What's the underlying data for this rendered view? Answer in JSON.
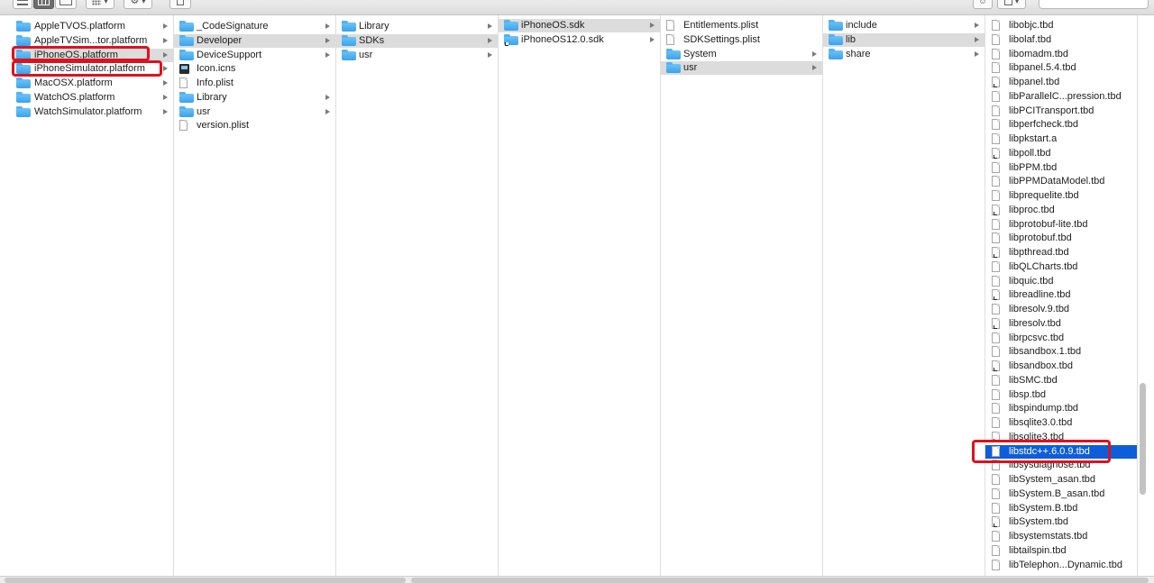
{
  "toolbar": {
    "buttons": [
      {
        "name": "list-view-icon"
      },
      {
        "name": "column-view-icon"
      },
      {
        "name": "cover-flow-icon"
      },
      {
        "name": "arrange-icon"
      },
      {
        "name": "action-gear-icon"
      },
      {
        "name": "share-icon"
      },
      {
        "name": "user-icon"
      },
      {
        "name": "tags-icon"
      }
    ],
    "search_placeholder": ""
  },
  "columns": [
    {
      "items": [
        {
          "label": "AppleTVOS.platform",
          "type": "folder",
          "arrow": true
        },
        {
          "label": "AppleTVSim...tor.platform",
          "type": "folder",
          "arrow": true
        },
        {
          "label": "iPhoneOS.platform",
          "type": "folder",
          "arrow": true,
          "state": "highlight"
        },
        {
          "label": "iPhoneSimulator.platform",
          "type": "folder",
          "arrow": true
        },
        {
          "label": "MacOSX.platform",
          "type": "folder",
          "arrow": true
        },
        {
          "label": "WatchOS.platform",
          "type": "folder",
          "arrow": true
        },
        {
          "label": "WatchSimulator.platform",
          "type": "folder",
          "arrow": true
        }
      ]
    },
    {
      "items": [
        {
          "label": "_CodeSignature",
          "type": "folder",
          "arrow": true
        },
        {
          "label": "Developer",
          "type": "folder",
          "arrow": true,
          "state": "highlight"
        },
        {
          "label": "DeviceSupport",
          "type": "folder",
          "arrow": true
        },
        {
          "label": "Icon.icns",
          "type": "exec"
        },
        {
          "label": "Info.plist",
          "type": "doc"
        },
        {
          "label": "Library",
          "type": "folder",
          "arrow": true
        },
        {
          "label": "usr",
          "type": "folder",
          "arrow": true
        },
        {
          "label": "version.plist",
          "type": "doc"
        }
      ]
    },
    {
      "items": [
        {
          "label": "Library",
          "type": "folder",
          "arrow": true
        },
        {
          "label": "SDKs",
          "type": "folder",
          "arrow": true,
          "state": "highlight"
        },
        {
          "label": "usr",
          "type": "folder",
          "arrow": true
        }
      ]
    },
    {
      "items": [
        {
          "label": "iPhoneOS.sdk",
          "type": "folder",
          "arrow": true,
          "state": "highlight"
        },
        {
          "label": "iPhoneOS12.0.sdk",
          "type": "folder",
          "arrow": true,
          "alias": true
        }
      ]
    },
    {
      "items": [
        {
          "label": "Entitlements.plist",
          "type": "doc"
        },
        {
          "label": "SDKSettings.plist",
          "type": "doc"
        },
        {
          "label": "System",
          "type": "folder",
          "arrow": true
        },
        {
          "label": "usr",
          "type": "folder",
          "arrow": true,
          "state": "highlight"
        }
      ]
    },
    {
      "items": [
        {
          "label": "include",
          "type": "folder",
          "arrow": true
        },
        {
          "label": "lib",
          "type": "folder",
          "arrow": true,
          "state": "highlight"
        },
        {
          "label": "share",
          "type": "folder",
          "arrow": true
        }
      ]
    },
    {
      "items": [
        {
          "label": "libobjc.tbd",
          "type": "doc"
        },
        {
          "label": "libolaf.tbd",
          "type": "doc"
        },
        {
          "label": "libomadm.tbd",
          "type": "doc"
        },
        {
          "label": "libpanel.5.4.tbd",
          "type": "doc"
        },
        {
          "label": "libpanel.tbd",
          "type": "doc",
          "alias": true
        },
        {
          "label": "libParallelC...pression.tbd",
          "type": "doc"
        },
        {
          "label": "libPCITransport.tbd",
          "type": "doc"
        },
        {
          "label": "libperfcheck.tbd",
          "type": "doc"
        },
        {
          "label": "libpkstart.a",
          "type": "doc"
        },
        {
          "label": "libpoll.tbd",
          "type": "doc",
          "alias": true
        },
        {
          "label": "libPPM.tbd",
          "type": "doc"
        },
        {
          "label": "libPPMDataModel.tbd",
          "type": "doc"
        },
        {
          "label": "libprequelite.tbd",
          "type": "doc"
        },
        {
          "label": "libproc.tbd",
          "type": "doc",
          "alias": true
        },
        {
          "label": "libprotobuf-lite.tbd",
          "type": "doc"
        },
        {
          "label": "libprotobuf.tbd",
          "type": "doc"
        },
        {
          "label": "libpthread.tbd",
          "type": "doc",
          "alias": true
        },
        {
          "label": "libQLCharts.tbd",
          "type": "doc"
        },
        {
          "label": "libquic.tbd",
          "type": "doc"
        },
        {
          "label": "libreadline.tbd",
          "type": "doc",
          "alias": true
        },
        {
          "label": "libresolv.9.tbd",
          "type": "doc"
        },
        {
          "label": "libresolv.tbd",
          "type": "doc",
          "alias": true
        },
        {
          "label": "librpcsvc.tbd",
          "type": "doc"
        },
        {
          "label": "libsandbox.1.tbd",
          "type": "doc"
        },
        {
          "label": "libsandbox.tbd",
          "type": "doc",
          "alias": true
        },
        {
          "label": "libSMC.tbd",
          "type": "doc"
        },
        {
          "label": "libsp.tbd",
          "type": "doc"
        },
        {
          "label": "libspindump.tbd",
          "type": "doc"
        },
        {
          "label": "libsqlite3.0.tbd",
          "type": "doc"
        },
        {
          "label": "libsqlite3.tbd",
          "type": "doc",
          "alias": true
        },
        {
          "label": "libstdc++.6.0.9.tbd",
          "type": "doc",
          "state": "selected"
        },
        {
          "label": "libsysdiagnose.tbd",
          "type": "doc"
        },
        {
          "label": "libSystem_asan.tbd",
          "type": "doc"
        },
        {
          "label": "libSystem.B_asan.tbd",
          "type": "doc"
        },
        {
          "label": "libSystem.B.tbd",
          "type": "doc"
        },
        {
          "label": "libSystem.tbd",
          "type": "doc",
          "alias": true
        },
        {
          "label": "libsystemstats.tbd",
          "type": "doc"
        },
        {
          "label": "libtailspin.tbd",
          "type": "doc"
        },
        {
          "label": "libTelephon...Dynamic.tbd",
          "type": "doc"
        }
      ]
    }
  ],
  "annotation_color": "#e0111c",
  "selection_color": "#0e5ed9"
}
